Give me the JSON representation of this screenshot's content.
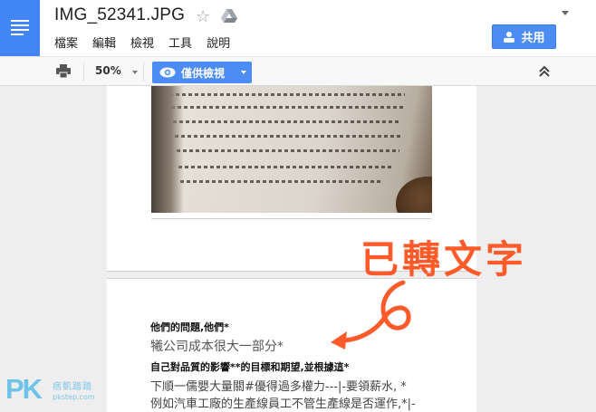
{
  "header": {
    "title": "IMG_52341.JPG",
    "menu": [
      "檔案",
      "編輯",
      "檢視",
      "工具",
      "說明"
    ],
    "share_label": "共用"
  },
  "toolbar": {
    "zoom": "50%",
    "mode_label": "僅供檢視"
  },
  "document": {
    "ocr_lines": [
      "他們的問題,他們*",
      "犧公司成本很大一部分*",
      "自己對品質的影響**的目標和期望,並根據這*",
      "下順一儒嬰大量關#優得過多權力---|-要領薪水, *",
      "例如汽車工廠的生產線員工不管生產線是否運作,*|-"
    ]
  },
  "annotation": {
    "label": "已轉文字",
    "color": "#ff5a2a"
  },
  "watermark": {
    "logo": "PK",
    "name": "痞凱踏踏",
    "url": "pkstep.com"
  },
  "colors": {
    "accent": "#4285f4",
    "button": "#4b8cf5"
  }
}
